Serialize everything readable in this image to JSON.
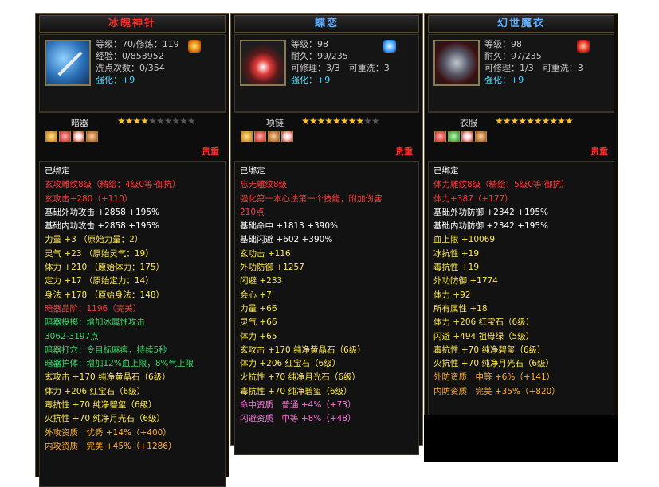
{
  "panels": [
    {
      "title": "冰魄神针",
      "stats": {
        "level": "等级：70/修炼：119",
        "exp": "经验：0/853952",
        "wash": "洗点次数：0/354",
        "enhance_label": "强化：",
        "enhance_value": "+9"
      },
      "type": "暗器",
      "stars_on": 4,
      "stars_total": 10,
      "worth": "贵重",
      "lines": [
        {
          "text": "已绑定",
          "color": "c-w"
        },
        {
          "text": "玄攻雕纹8级（精绘：4级0等·御抗）",
          "color": "c-r"
        },
        {
          "text": "玄攻击+280（+110）",
          "color": "c-r"
        },
        {
          "text": "基础外功攻击 +2858 +195%",
          "color": "c-w"
        },
        {
          "text": "基础内功攻击 +2858 +195%",
          "color": "c-w"
        },
        {
          "text": "力量 +3 （原始力量：2）",
          "color": "c-y"
        },
        {
          "text": "灵气 +23 （原始灵气：19）",
          "color": "c-y"
        },
        {
          "text": "体力 +210 （原始体力：175）",
          "color": "c-y"
        },
        {
          "text": "定力 +17 （原始定力：14）",
          "color": "c-y"
        },
        {
          "text": "身法 +178 （原始身法：148）",
          "color": "c-y"
        },
        {
          "text": "暗器品阶：1196（完美）",
          "color": "c-r"
        },
        {
          "text": "暗器投掷：增加冰属性攻击",
          "color": "c-g"
        },
        {
          "text": "3062-3197点",
          "color": "c-g"
        },
        {
          "text": "暗器打穴：令目标麻痹，持续5秒",
          "color": "c-g"
        },
        {
          "text": "暗器护体：增加12%血上限，8%气上限",
          "color": "c-g"
        },
        {
          "text": "玄攻击 +170 纯净黄晶石（6级）",
          "color": "c-y"
        },
        {
          "text": "体力 +206 红宝石（6级）",
          "color": "c-y"
        },
        {
          "text": "毒抗性 +70 纯净碧玺（6级）",
          "color": "c-y"
        },
        {
          "text": "火抗性 +70 纯净月光石（6级）",
          "color": "c-y"
        },
        {
          "text": "外攻资质　忧秀 +14%（+400）",
          "color": "c-o"
        },
        {
          "text": "内攻资质　完美 +45%（+1286）",
          "color": "c-o"
        }
      ]
    },
    {
      "title": "蝶恋",
      "stats": {
        "level": "等级：98",
        "durability": "耐久：99/235",
        "repair": "可修理：3/3",
        "rewash": "可重洗：3",
        "enhance_label": "强化：",
        "enhance_value": "+9"
      },
      "type": "项链",
      "stars_on": 8,
      "stars_total": 10,
      "worth": "贵重",
      "lines": [
        {
          "text": "已绑定",
          "color": "c-w"
        },
        {
          "text": "忘无雕纹8级",
          "color": "c-r"
        },
        {
          "text": "强化第一本心法第一个技能，附加伤害",
          "color": "c-r"
        },
        {
          "text": "210点",
          "color": "c-r"
        },
        {
          "text": "基础命中 +1813 +390%",
          "color": "c-w"
        },
        {
          "text": "基础闪避 +602 +390%",
          "color": "c-w"
        },
        {
          "text": "玄功击 +116",
          "color": "c-y"
        },
        {
          "text": "外功防御 +1257",
          "color": "c-y"
        },
        {
          "text": "闪避 +233",
          "color": "c-y"
        },
        {
          "text": "会心 +7",
          "color": "c-y"
        },
        {
          "text": "力量 +66",
          "color": "c-y"
        },
        {
          "text": "灵气 +66",
          "color": "c-y"
        },
        {
          "text": "体力 +65",
          "color": "c-y"
        },
        {
          "text": "玄攻击 +170 纯净黄晶石（6级）",
          "color": "c-y"
        },
        {
          "text": "体力 +206 红宝石（6级）",
          "color": "c-y"
        },
        {
          "text": "火抗性 +70 纯净月光石（6级）",
          "color": "c-y"
        },
        {
          "text": "毒抗性 +70 纯净碧玺（6级）",
          "color": "c-y"
        },
        {
          "text": "命中资质　普通 +4%（+73）",
          "color": "c-p"
        },
        {
          "text": "闪避资质　中等 +8%（+48）",
          "color": "c-p"
        }
      ]
    },
    {
      "title": "幻世魔衣",
      "stats": {
        "level": "等级：98",
        "durability": "耐久：97/235",
        "repair": "可修理：1/3",
        "rewash": "可重洗：3",
        "enhance_label": "强化：",
        "enhance_value": "+9"
      },
      "type": "衣服",
      "stars_on": 10,
      "stars_total": 10,
      "worth": "贵重",
      "lines": [
        {
          "text": "已绑定",
          "color": "c-w"
        },
        {
          "text": "体力雕纹8级（精绘：5级0等·御抗）",
          "color": "c-r"
        },
        {
          "text": "体力+387（+177）",
          "color": "c-r"
        },
        {
          "text": "基础外功防御 +2342 +195%",
          "color": "c-w"
        },
        {
          "text": "基础内功防御 +2342 +195%",
          "color": "c-w"
        },
        {
          "text": "血上限 +10069",
          "color": "c-y"
        },
        {
          "text": "冰抗性 +19",
          "color": "c-y"
        },
        {
          "text": "毒抗性 +19",
          "color": "c-y"
        },
        {
          "text": "外功防御 +1774",
          "color": "c-y"
        },
        {
          "text": "体力 +92",
          "color": "c-y"
        },
        {
          "text": "所有属性 +18",
          "color": "c-y"
        },
        {
          "text": "体力 +206 红宝石（6级）",
          "color": "c-y"
        },
        {
          "text": "闪避 +494 祖母绿（5级）",
          "color": "c-y"
        },
        {
          "text": "毒抗性 +70 纯净碧玺（6级）",
          "color": "c-y"
        },
        {
          "text": "火抗性 +70 纯净月光石（6级）",
          "color": "c-y"
        },
        {
          "text": "外防资质　中等 +6%（+141）",
          "color": "c-o"
        },
        {
          "text": "内防资质　完美 +35%（+820）",
          "color": "c-o"
        }
      ]
    }
  ]
}
